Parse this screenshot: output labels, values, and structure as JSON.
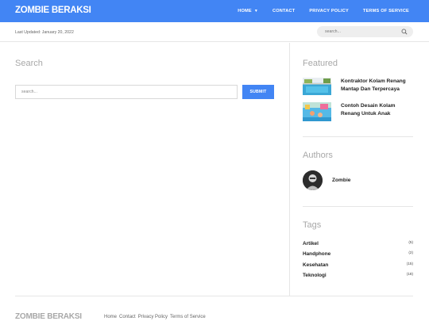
{
  "header": {
    "brand": "ZOMBIE BERAKSI",
    "nav": [
      "HOME",
      "CONTACT",
      "PRIVACY POLICY",
      "TERMS OF SERVICE"
    ],
    "accent_color": "#4285f4"
  },
  "subbar": {
    "last_updated": "Last Updated: January 20, 2022",
    "search_placeholder": "search..."
  },
  "main": {
    "title": "Search",
    "search_placeholder": "search...",
    "submit_label": "SUBMIT"
  },
  "sidebar": {
    "featured_title": "Featured",
    "featured": [
      {
        "title": "Kontraktor Kolam Renang Mantap Dan Terpercaya",
        "thumb": "pool-photo"
      },
      {
        "title": "Contoh Desain Kolam Renang Untuk Anak",
        "thumb": "kids-pool-photo"
      }
    ],
    "authors_title": "Authors",
    "author_name": "Zombie",
    "tags_title": "Tags",
    "tags": [
      {
        "name": "Artikel",
        "count": "(5)"
      },
      {
        "name": "Handphone",
        "count": "(2)"
      },
      {
        "name": "Kesehatan",
        "count": "(15)"
      },
      {
        "name": "Teknologi",
        "count": "(18)"
      }
    ]
  },
  "footer": {
    "brand": "ZOMBIE BERAKSI",
    "links": [
      "Home",
      "Contact",
      "Privacy Policy",
      "Terms of Service"
    ]
  }
}
